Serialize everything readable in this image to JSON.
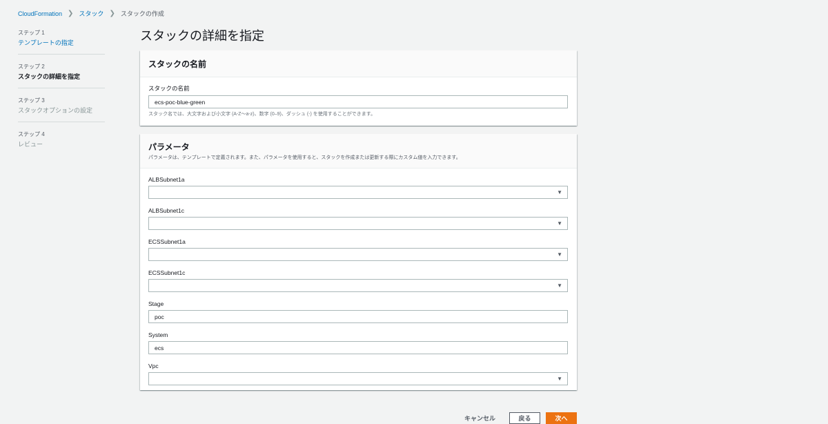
{
  "breadcrumb": {
    "items": [
      "CloudFormation",
      "スタック",
      "スタックの作成"
    ]
  },
  "steps": [
    {
      "num": "ステップ 1",
      "name": "テンプレートの指定",
      "state": "link"
    },
    {
      "num": "ステップ 2",
      "name": "スタックの詳細を指定",
      "state": "active"
    },
    {
      "num": "ステップ 3",
      "name": "スタックオプションの設定",
      "state": "disabled"
    },
    {
      "num": "ステップ 4",
      "name": "レビュー",
      "state": "disabled"
    }
  ],
  "page_title": "スタックの詳細を指定",
  "stack_name_panel": {
    "title": "スタックの名前",
    "field_label": "スタックの名前",
    "value": "ecs-poc-blue-green",
    "help": "スタック名では、大文字および小文字 (A-Z〜a-z)、数字 (0–9)、ダッシュ (-) を使用することができます。"
  },
  "params_panel": {
    "title": "パラメータ",
    "description": "パラメータは、テンプレートで定義されます。また、パラメータを使用すると、スタックを作成または更新する際にカスタム値を入力できます。",
    "fields": [
      {
        "label": "ALBSubnet1a",
        "type": "select",
        "value": ""
      },
      {
        "label": "ALBSubnet1c",
        "type": "select",
        "value": ""
      },
      {
        "label": "ECSSubnet1a",
        "type": "select",
        "value": ""
      },
      {
        "label": "ECSSubnet1c",
        "type": "select",
        "value": ""
      },
      {
        "label": "Stage",
        "type": "input",
        "value": "poc"
      },
      {
        "label": "System",
        "type": "input",
        "value": "ecs"
      },
      {
        "label": "Vpc",
        "type": "select",
        "value": ""
      }
    ]
  },
  "footer": {
    "cancel_label": "キャンセル",
    "back_label": "戻る",
    "next_label": "次へ"
  },
  "colors": {
    "accent": "#0073bb",
    "primary_button": "#ec7211"
  },
  "icons": {
    "breadcrumb_separator": "chevron-right-icon",
    "select_caret": "caret-down-icon"
  }
}
